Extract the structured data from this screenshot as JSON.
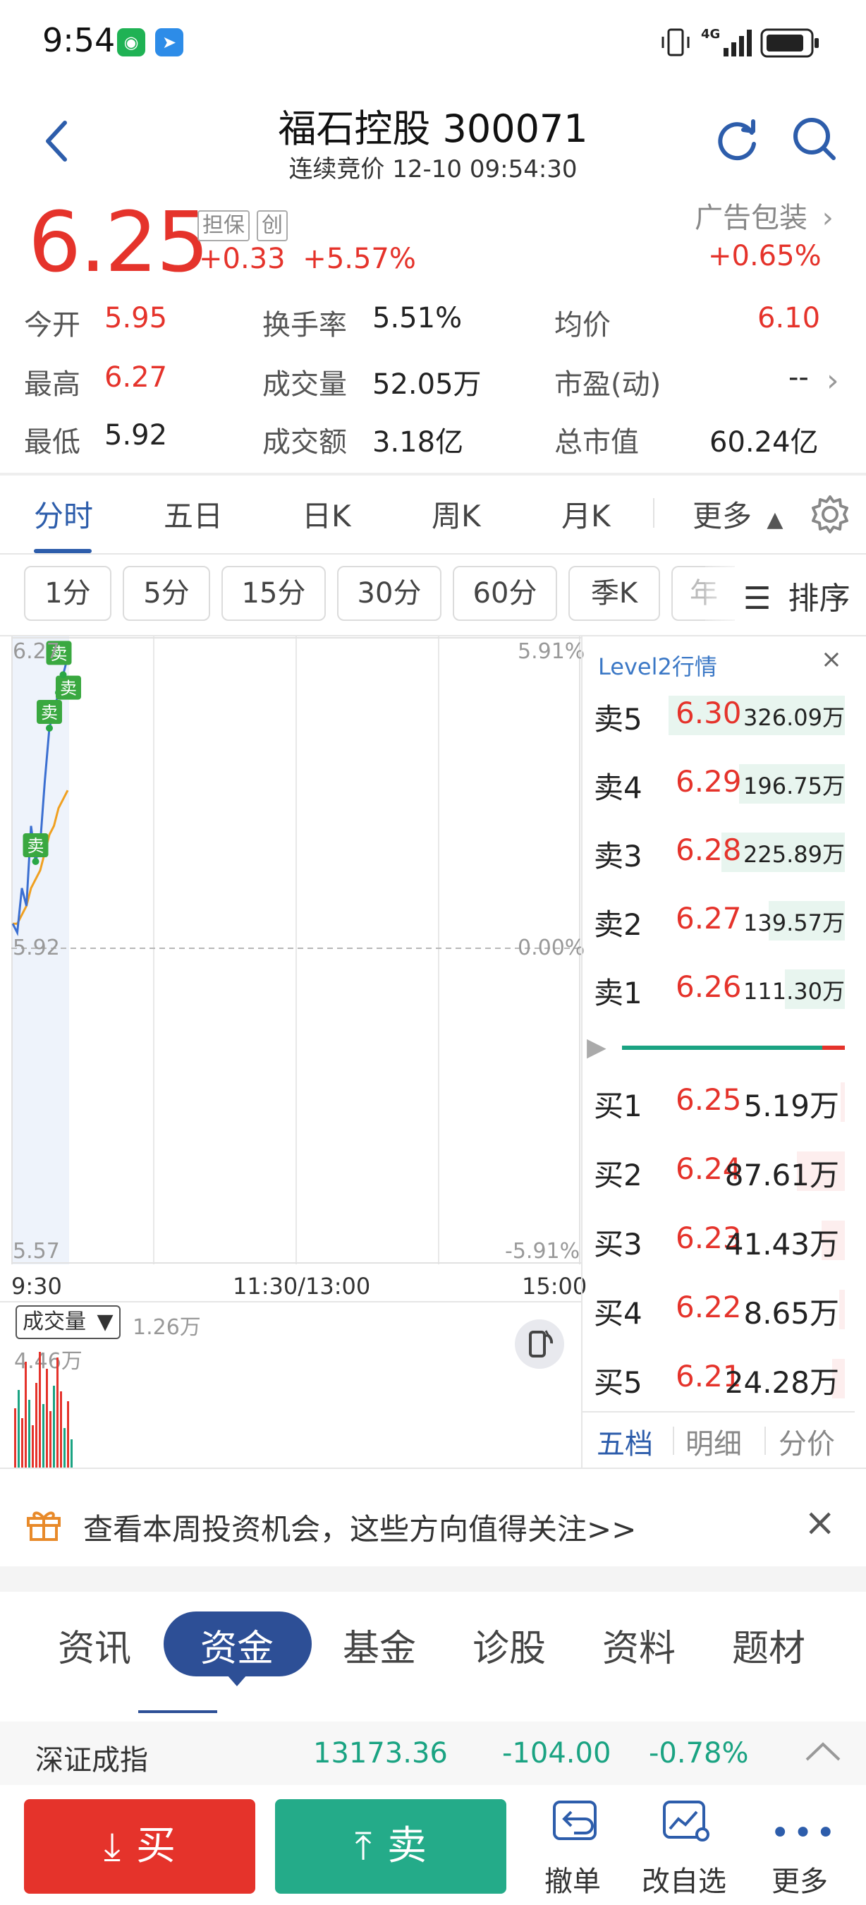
{
  "status": {
    "time": "9:54",
    "network": "4G"
  },
  "header": {
    "title": "福石控股 300071",
    "subtitle": "连续竞价 12-10 09:54:30"
  },
  "quote": {
    "price": "6.25",
    "tags": [
      "担保",
      "创"
    ],
    "change": "+0.33",
    "change_pct": "+5.57%",
    "industry": {
      "name": "广告包装",
      "pct": "+0.65%"
    }
  },
  "stats": [
    {
      "label": "今开",
      "value": "5.95",
      "color": "red"
    },
    {
      "label": "换手率",
      "value": "5.51%",
      "color": "black"
    },
    {
      "label": "均价",
      "value": "6.10",
      "color": "red"
    },
    {
      "label": "最高",
      "value": "6.27",
      "color": "red"
    },
    {
      "label": "成交量",
      "value": "52.05万",
      "color": "black"
    },
    {
      "label": "市盈(动)",
      "value": "--",
      "color": "black"
    },
    {
      "label": "最低",
      "value": "5.92",
      "color": "black"
    },
    {
      "label": "成交额",
      "value": "3.18亿",
      "color": "black"
    },
    {
      "label": "总市值",
      "value": "60.24亿",
      "color": "black"
    }
  ],
  "chart_tabs": {
    "items": [
      "分时",
      "五日",
      "日K",
      "周K",
      "月K"
    ],
    "active": "分时",
    "more": "更多"
  },
  "intervals": {
    "items": [
      "1分",
      "5分",
      "15分",
      "30分",
      "60分",
      "季K",
      "年"
    ],
    "sort": "排序"
  },
  "chart_labels": {
    "y_top": "6.27",
    "y_mid": "5.92",
    "y_bottom": "5.57",
    "pct_top": "5.91%",
    "pct_mid": "0.00%",
    "pct_bottom": "-5.91%",
    "time_start": "9:30",
    "time_mid": "11:30/13:00",
    "time_end": "15:00",
    "sell_marker": "卖"
  },
  "chart_data": {
    "type": "line",
    "title": "",
    "ylim": [
      5.57,
      6.27
    ],
    "series": [
      {
        "values": [
          5.95,
          5.94,
          5.99,
          5.97,
          6.06,
          6.02,
          6.04,
          6.11,
          6.17,
          6.19,
          6.21,
          6.23,
          6.25
        ]
      },
      {
        "values": [
          5.95,
          5.95,
          5.96,
          5.97,
          5.99,
          6.0,
          6.01,
          6.03,
          6.05,
          6.06,
          6.08,
          6.09,
          6.1
        ]
      }
    ]
  },
  "orderbook": {
    "title": "Level2行情",
    "asks": [
      {
        "label": "卖5",
        "price": "6.30",
        "vol": "326.09万",
        "fill": 1.0
      },
      {
        "label": "卖4",
        "price": "6.29",
        "vol": "196.75万",
        "fill": 0.6
      },
      {
        "label": "卖3",
        "price": "6.28",
        "vol": "225.89万",
        "fill": 0.7
      },
      {
        "label": "卖2",
        "price": "6.27",
        "vol": "139.57万",
        "fill": 0.43
      },
      {
        "label": "卖1",
        "price": "6.26",
        "vol": "111.30万",
        "fill": 0.34
      }
    ],
    "bids": [
      {
        "label": "买1",
        "price": "6.25",
        "vol": "5.19万",
        "fill": 0.02
      },
      {
        "label": "买2",
        "price": "6.24",
        "vol": "87.61万",
        "fill": 0.27
      },
      {
        "label": "买3",
        "price": "6.23",
        "vol": "41.43万",
        "fill": 0.13
      },
      {
        "label": "买4",
        "price": "6.22",
        "vol": "8.65万",
        "fill": 0.03
      },
      {
        "label": "买5",
        "price": "6.21",
        "vol": "24.28万",
        "fill": 0.07
      }
    ],
    "ratio_buy": 0.9,
    "tabs": [
      "五档",
      "明细",
      "分价"
    ],
    "active_tab": "五档"
  },
  "volume": {
    "dropdown": "成交量",
    "current": "1.26万",
    "max": "4.46万"
  },
  "promo": {
    "text": "查看本周投资机会，这些方向值得关注>>"
  },
  "info_tabs": {
    "items": [
      "资讯",
      "资金",
      "基金",
      "诊股",
      "资料",
      "题材"
    ],
    "active": "资金"
  },
  "index": {
    "name": "深证成指",
    "value": "13173.36",
    "change": "-104.00",
    "pct": "-0.78%"
  },
  "actions": {
    "buy": "买",
    "sell": "卖",
    "cancel": "撤单",
    "watchlist": "改自选",
    "more": "更多"
  },
  "colors": {
    "up": "#e5332b",
    "down": "#1aa382",
    "accent": "#2d5dab",
    "price_line": "#3b6fd1",
    "avg_line": "#f0a020"
  }
}
